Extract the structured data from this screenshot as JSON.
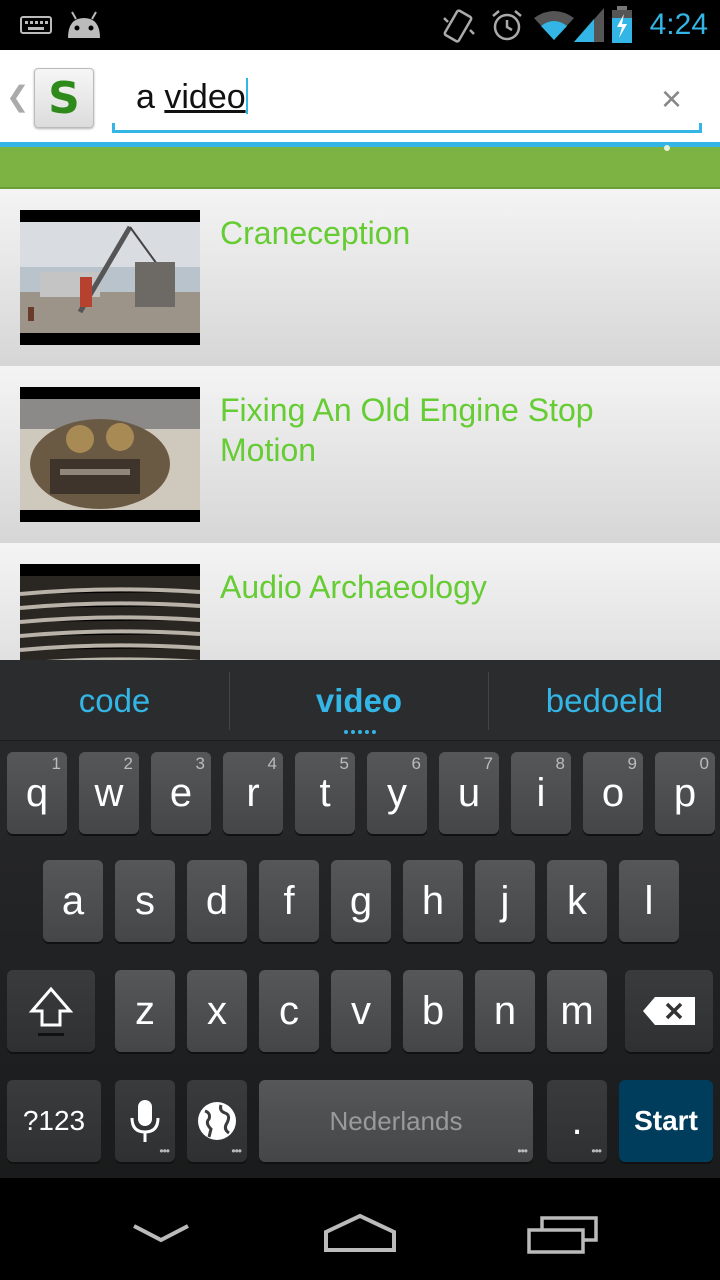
{
  "status_bar": {
    "time": "4:24",
    "icons": [
      "keyboard-icon",
      "android-icon",
      "vibrate-icon",
      "alarm-icon",
      "wifi-icon",
      "signal-icon",
      "battery-icon"
    ]
  },
  "search": {
    "query_prefix": "a ",
    "query_word": "video",
    "clear_label": "×",
    "logo_letter": "S"
  },
  "results": [
    {
      "title": "Craneception"
    },
    {
      "title": "Fixing An Old Engine Stop Motion"
    },
    {
      "title": "Audio Archaeology"
    }
  ],
  "keyboard": {
    "suggestions": [
      "code",
      "video",
      "bedoeld"
    ],
    "row1": [
      {
        "k": "q",
        "n": "1"
      },
      {
        "k": "w",
        "n": "2"
      },
      {
        "k": "e",
        "n": "3"
      },
      {
        "k": "r",
        "n": "4"
      },
      {
        "k": "t",
        "n": "5"
      },
      {
        "k": "y",
        "n": "6"
      },
      {
        "k": "u",
        "n": "7"
      },
      {
        "k": "i",
        "n": "8"
      },
      {
        "k": "o",
        "n": "9"
      },
      {
        "k": "p",
        "n": "0"
      }
    ],
    "row2": [
      "a",
      "s",
      "d",
      "f",
      "g",
      "h",
      "j",
      "k",
      "l"
    ],
    "row3": [
      "z",
      "x",
      "c",
      "v",
      "b",
      "n",
      "m"
    ],
    "symbols_label": "?123",
    "space_label": "Nederlands",
    "period_label": ".",
    "action_label": "Start"
  },
  "colors": {
    "accent": "#33b5e5",
    "green_bar": "#7cb342",
    "title_green": "#66cc33",
    "action_key": "#003d5c"
  }
}
